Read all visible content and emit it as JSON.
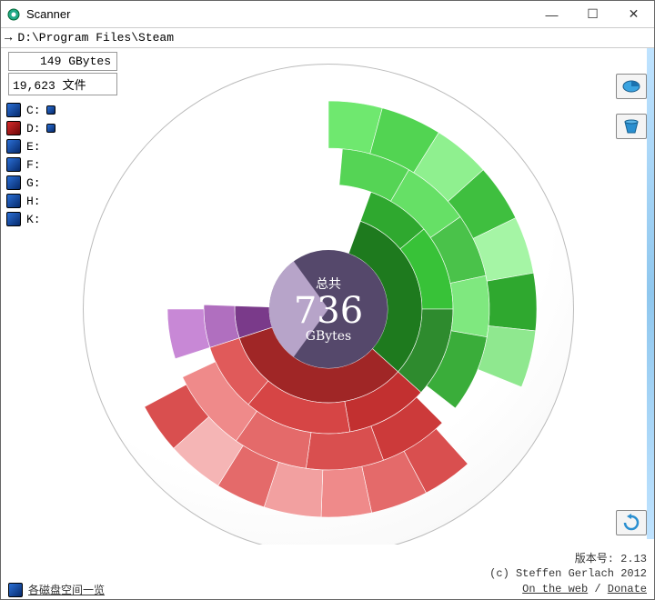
{
  "window": {
    "title": "Scanner",
    "path_arrow": "→",
    "path": "D:\\Program Files\\Steam",
    "size_line": "149 GBytes",
    "files_line": "19,623 文件"
  },
  "drives": [
    {
      "label": "C:",
      "selected": false,
      "color": "blue",
      "expand": true
    },
    {
      "label": "D:",
      "selected": true,
      "color": "red",
      "expand": true
    },
    {
      "label": "E:",
      "selected": false,
      "color": "blue",
      "expand": false
    },
    {
      "label": "F:",
      "selected": false,
      "color": "blue",
      "expand": false
    },
    {
      "label": "G:",
      "selected": false,
      "color": "blue",
      "expand": false
    },
    {
      "label": "H:",
      "selected": false,
      "color": "blue",
      "expand": false
    },
    {
      "label": "K:",
      "selected": false,
      "color": "blue",
      "expand": false
    }
  ],
  "center": {
    "t1": "总共",
    "value": "736",
    "unit": "GBytes"
  },
  "right_tools": {
    "pie_icon": "pie-icon",
    "cup_icon": "cup-icon"
  },
  "refresh_icon": "refresh-icon",
  "footer": {
    "left_icon": "overview-icon",
    "left_label": "各磁盘空间一览",
    "version_label": "版本号:  2.13",
    "copyright": "(c) Steffen Gerlach 2012",
    "link1": "On the web",
    "link2": "Donate"
  },
  "chart_data": {
    "type": "sunburst",
    "title": "Disk usage sunburst — D:\\Program Files\\Steam",
    "total_label": "736 GBytes",
    "center_used_fraction_shaded": 0.7,
    "rings": [
      {
        "level": 1,
        "slices": [
          {
            "name": "green-main",
            "start_deg": 0,
            "end_deg": 112,
            "color": "#1e7a1e"
          },
          {
            "name": "red-main",
            "start_deg": 112,
            "end_deg": 232,
            "color": "#a02626"
          },
          {
            "name": "misc",
            "start_deg": 232,
            "end_deg": 252,
            "color": "#7a3a8a"
          }
        ]
      },
      {
        "level": 2,
        "slices": [
          {
            "name": "g2a",
            "start_deg": 0,
            "end_deg": 30,
            "color": "#2fa82f"
          },
          {
            "name": "g2b",
            "start_deg": 30,
            "end_deg": 70,
            "color": "#38c238"
          },
          {
            "name": "g2c",
            "start_deg": 70,
            "end_deg": 112,
            "color": "#2e8b2e"
          },
          {
            "name": "r2a",
            "start_deg": 112,
            "end_deg": 150,
            "color": "#c23030"
          },
          {
            "name": "r2b",
            "start_deg": 150,
            "end_deg": 200,
            "color": "#d64545"
          },
          {
            "name": "r2c",
            "start_deg": 200,
            "end_deg": 232,
            "color": "#e05a5a"
          },
          {
            "name": "m2",
            "start_deg": 232,
            "end_deg": 252,
            "color": "#b06fbf"
          }
        ]
      },
      {
        "level": 3,
        "slices": [
          {
            "name": "g3a",
            "start_deg": -15,
            "end_deg": 10,
            "color": "#55d455"
          },
          {
            "name": "g3b",
            "start_deg": 10,
            "end_deg": 35,
            "color": "#66e066"
          },
          {
            "name": "g3c",
            "start_deg": 35,
            "end_deg": 58,
            "color": "#4ac24a"
          },
          {
            "name": "g3d",
            "start_deg": 58,
            "end_deg": 80,
            "color": "#7fe87f"
          },
          {
            "name": "g3e",
            "start_deg": 80,
            "end_deg": 108,
            "color": "#3aad3a"
          },
          {
            "name": "r3a",
            "start_deg": 115,
            "end_deg": 140,
            "color": "#cc3a3a"
          },
          {
            "name": "r3b",
            "start_deg": 140,
            "end_deg": 168,
            "color": "#d94f4f"
          },
          {
            "name": "r3c",
            "start_deg": 168,
            "end_deg": 195,
            "color": "#e46a6a"
          },
          {
            "name": "r3d",
            "start_deg": 195,
            "end_deg": 225,
            "color": "#ef8a8a"
          },
          {
            "name": "m3",
            "start_deg": 232,
            "end_deg": 250,
            "color": "#c888d6"
          }
        ]
      },
      {
        "level": 4,
        "slices": [
          {
            "name": "g4a",
            "start_deg": -20,
            "end_deg": -5,
            "color": "#6fe86f"
          },
          {
            "name": "g4b",
            "start_deg": -5,
            "end_deg": 12,
            "color": "#52d452"
          },
          {
            "name": "g4c",
            "start_deg": 12,
            "end_deg": 28,
            "color": "#8ff08f"
          },
          {
            "name": "g4d",
            "start_deg": 28,
            "end_deg": 44,
            "color": "#3fbf3f"
          },
          {
            "name": "g4e",
            "start_deg": 44,
            "end_deg": 60,
            "color": "#a5f5a5"
          },
          {
            "name": "g4f",
            "start_deg": 60,
            "end_deg": 76,
            "color": "#2fa82f"
          },
          {
            "name": "g4g",
            "start_deg": 76,
            "end_deg": 92,
            "color": "#8fe88f"
          },
          {
            "name": "r4a",
            "start_deg": 118,
            "end_deg": 132,
            "color": "#d94f4f"
          },
          {
            "name": "r4b",
            "start_deg": 132,
            "end_deg": 148,
            "color": "#e46a6a"
          },
          {
            "name": "r4c",
            "start_deg": 148,
            "end_deg": 162,
            "color": "#ef8a8a"
          },
          {
            "name": "r4d",
            "start_deg": 162,
            "end_deg": 178,
            "color": "#f2a0a0"
          },
          {
            "name": "r4e",
            "start_deg": 178,
            "end_deg": 192,
            "color": "#e46a6a"
          },
          {
            "name": "r4f",
            "start_deg": 192,
            "end_deg": 208,
            "color": "#f5b5b5"
          },
          {
            "name": "r4g",
            "start_deg": 208,
            "end_deg": 222,
            "color": "#d94f4f"
          }
        ]
      }
    ]
  }
}
